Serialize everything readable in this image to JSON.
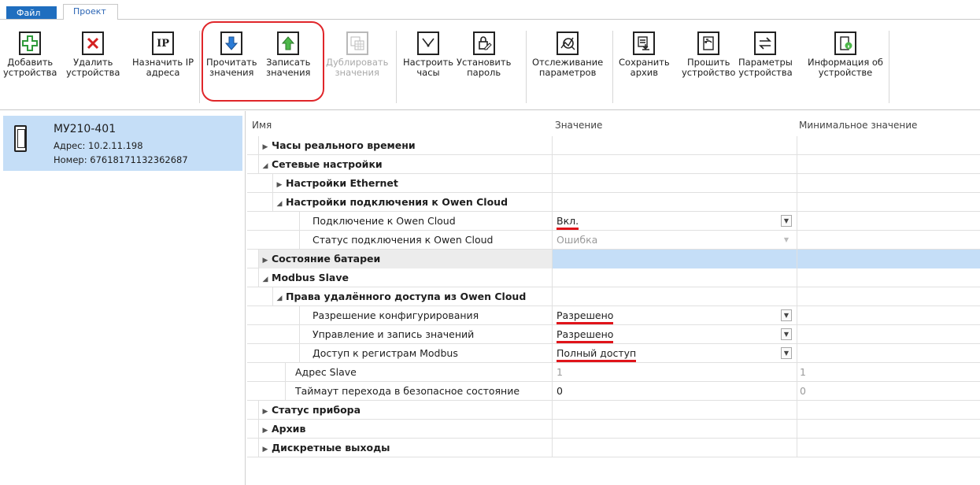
{
  "tabs": {
    "file": "Файл",
    "project": "Проект"
  },
  "ribbon": {
    "add_devices": "Добавить\nустройства",
    "remove_devices": "Удалить\nустройства",
    "assign_ip": "Назначить IP\nадреса",
    "ip_icon_text": "IP",
    "read_values": "Прочитать\nзначения",
    "write_values": "Записать\nзначения",
    "duplicate_values": "Дублировать\nзначения",
    "set_clock": "Настроить\nчасы",
    "set_password": "Установить\nпароль",
    "monitor_params": "Отслеживание\nпараметров",
    "save_archive": "Сохранить\nархив",
    "flash_device": "Прошить\nустройство",
    "device_params": "Параметры\nустройства",
    "device_info": "Информация об\nустройстве"
  },
  "device": {
    "name": "МУ210-401",
    "address": "Адрес: 10.2.11.198",
    "number": "Номер: 67618171132362687"
  },
  "grid": {
    "col_name": "Имя",
    "col_value": "Значение",
    "col_min": "Минимальное значение",
    "rows": [
      {
        "name": "Часы реального времени",
        "value": "",
        "min": ""
      },
      {
        "name": "Сетевые настройки",
        "value": "",
        "min": ""
      },
      {
        "name": "Настройки Ethernet",
        "value": "",
        "min": ""
      },
      {
        "name": "Настройки подключения к Owen Cloud",
        "value": "",
        "min": ""
      },
      {
        "name": "Подключение к Owen Cloud",
        "value": "Вкл.",
        "min": ""
      },
      {
        "name": "Статус подключения к Owen Cloud",
        "value": "Ошибка",
        "min": ""
      },
      {
        "name": "Состояние батареи",
        "value": "",
        "min": ""
      },
      {
        "name": "Modbus Slave",
        "value": "",
        "min": ""
      },
      {
        "name": "Права удалённого доступа из Owen Cloud",
        "value": "",
        "min": ""
      },
      {
        "name": "Разрешение конфигурирования",
        "value": "Разрешено",
        "min": ""
      },
      {
        "name": "Управление и запись значений",
        "value": "Разрешено",
        "min": ""
      },
      {
        "name": "Доступ к регистрам Modbus",
        "value": "Полный доступ",
        "min": ""
      },
      {
        "name": "Адрес Slave",
        "value": "1",
        "min": "1"
      },
      {
        "name": "Таймаут перехода в безопасное состояние",
        "value": "0",
        "min": "0"
      },
      {
        "name": "Статус прибора",
        "value": "",
        "min": ""
      },
      {
        "name": "Архив",
        "value": "",
        "min": ""
      },
      {
        "name": "Дискретные выходы",
        "value": "",
        "min": ""
      }
    ]
  },
  "colors": {
    "accent": "#1f6ebf",
    "selection": "#c5def7",
    "annotation": "#e0262a",
    "add_icon": "#2e9a3a",
    "remove_icon": "#d42020",
    "read_icon": "#2a7bd6",
    "write_icon": "#2e9a3a"
  }
}
